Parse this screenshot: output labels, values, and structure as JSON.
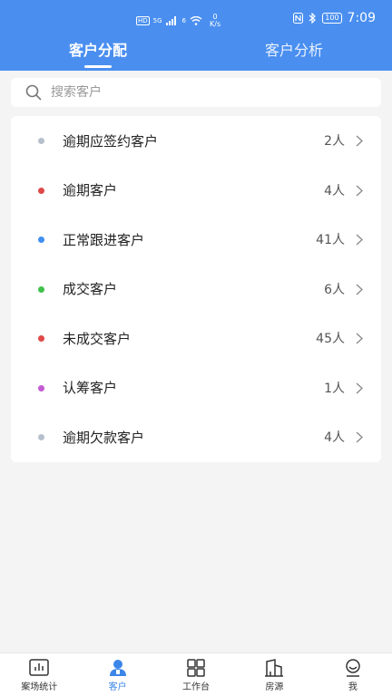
{
  "status_bar": {
    "left_badges": [
      "HD",
      "5G",
      "6"
    ],
    "speed_value": "0",
    "speed_unit": "K/s",
    "battery": "100",
    "time": "7:09"
  },
  "tabs": [
    {
      "label": "客户分配",
      "active": true
    },
    {
      "label": "客户分析",
      "active": false
    }
  ],
  "search": {
    "placeholder": "搜索客户",
    "value": ""
  },
  "list": {
    "items": [
      {
        "label": "逾期应签约客户",
        "count": "2人",
        "dot_color": "#b6c0cc"
      },
      {
        "label": "逾期客户",
        "count": "4人",
        "dot_color": "#e04848"
      },
      {
        "label": "正常跟进客户",
        "count": "41人",
        "dot_color": "#3f8ef0"
      },
      {
        "label": "成交客户",
        "count": "6人",
        "dot_color": "#3fc04b"
      },
      {
        "label": "未成交客户",
        "count": "45人",
        "dot_color": "#e04848"
      },
      {
        "label": "认筹客户",
        "count": "1人",
        "dot_color": "#c35bd2"
      },
      {
        "label": "逾期欠款客户",
        "count": "4人",
        "dot_color": "#b6c0cc"
      }
    ]
  },
  "bottom_nav": [
    {
      "label": "案场统计",
      "icon": "chart-icon",
      "active": false
    },
    {
      "label": "客户",
      "icon": "person-icon",
      "active": true
    },
    {
      "label": "工作台",
      "icon": "grid-icon",
      "active": false
    },
    {
      "label": "房源",
      "icon": "building-icon",
      "active": false
    },
    {
      "label": "我",
      "icon": "profile-icon",
      "active": false
    }
  ],
  "colors": {
    "primary": "#4a8ff0",
    "nav_active": "#3c86ea",
    "background": "#f4f4f4"
  }
}
